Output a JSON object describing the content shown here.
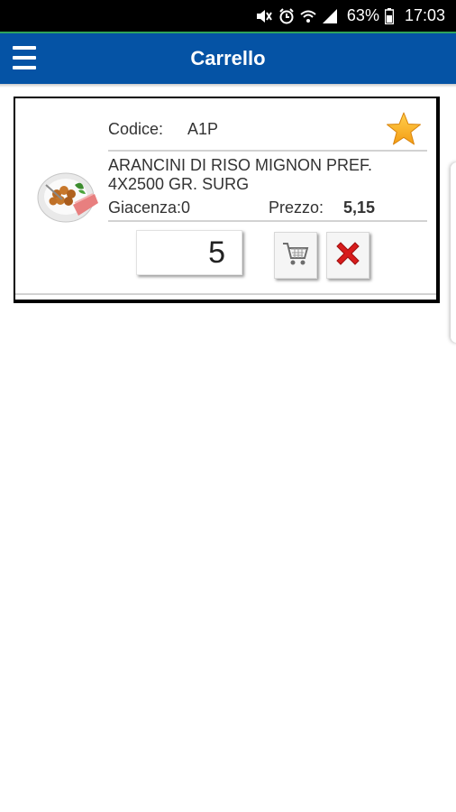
{
  "status_bar": {
    "battery": "63%",
    "time": "17:03",
    "icons": [
      "mute-icon",
      "alarm-icon",
      "wifi-icon",
      "signal-icon",
      "battery-icon"
    ]
  },
  "app_bar": {
    "title": "Carrello",
    "menu_icon": "hamburger-menu-icon",
    "background_color": "#0553a5"
  },
  "cart": {
    "items": [
      {
        "code_label": "Codice:",
        "code_value": "A1P",
        "name": "ARANCINI DI RISO MIGNON PREF. 4X2500 GR. SURG",
        "stock_label": "Giacenza:",
        "stock_value": "0",
        "price_label": "Prezzo:",
        "price_value": "5,15",
        "quantity": "5",
        "favorite_icon": "star-icon",
        "cart_icon": "shopping-cart-icon",
        "delete_icon": "close-icon"
      }
    ]
  }
}
